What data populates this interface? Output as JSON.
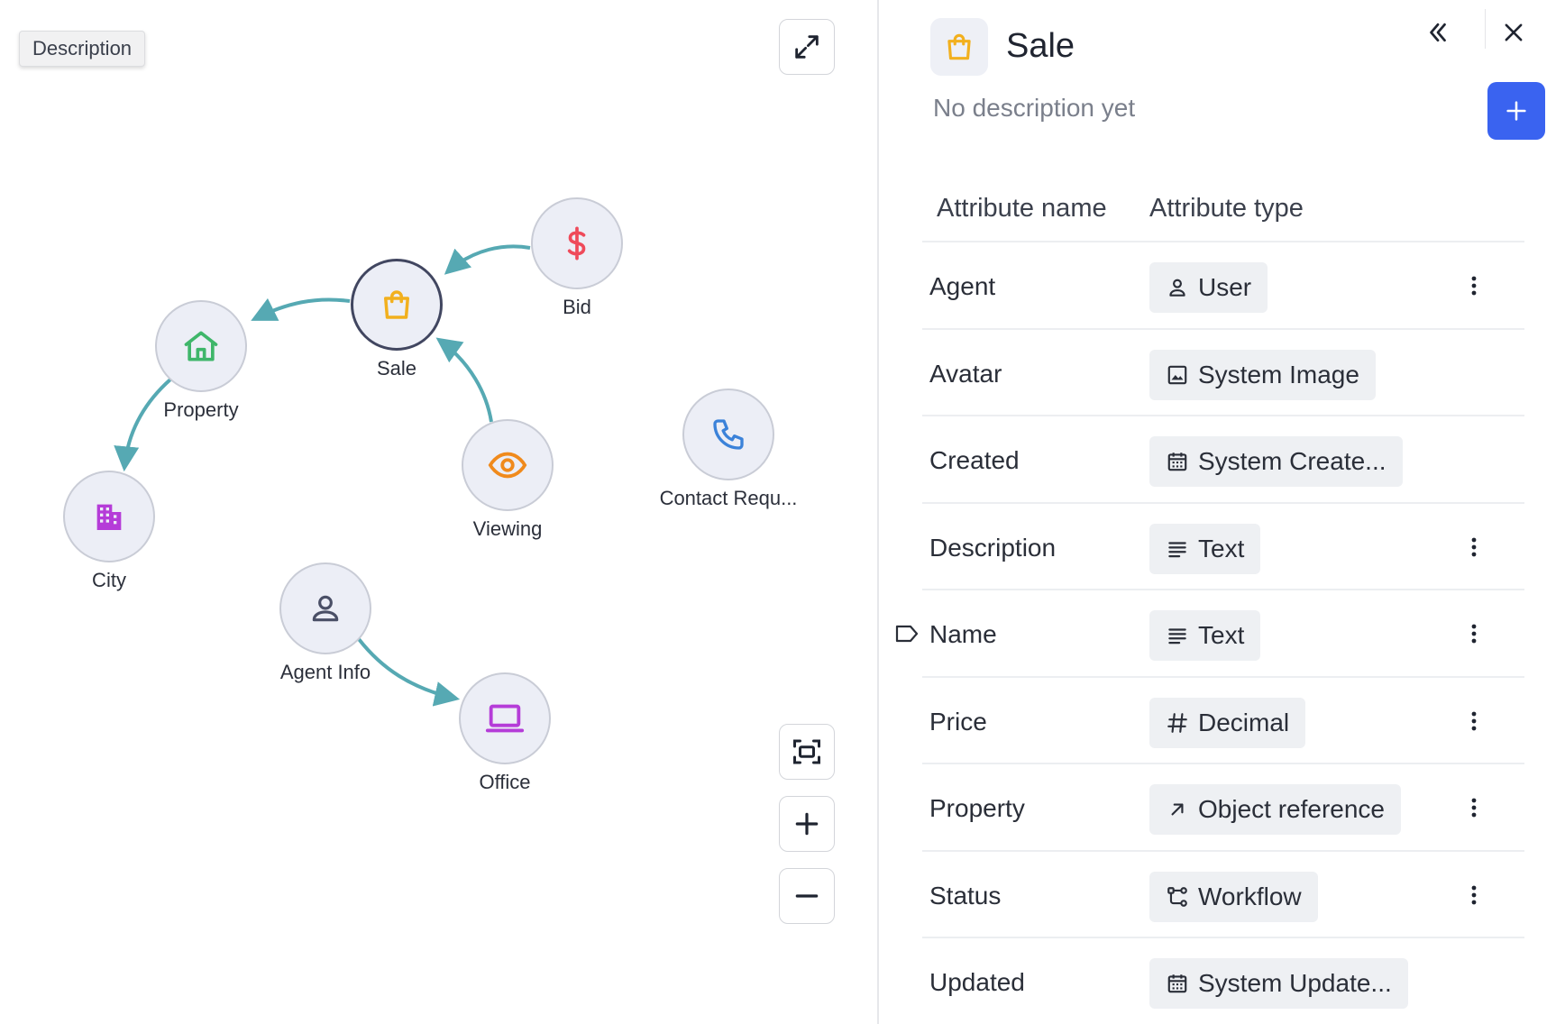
{
  "canvas": {
    "tooltip": "Description",
    "tools": {
      "expand": "expand-icon",
      "fit": "fit-view-icon",
      "zoom_in": "plus-icon",
      "zoom_out": "minus-icon"
    },
    "nodes": [
      {
        "id": "sale",
        "label": "Sale",
        "icon": "shopping-bag-icon",
        "color": "#f2b01e",
        "selected": true
      },
      {
        "id": "bid",
        "label": "Bid",
        "icon": "dollar-icon",
        "color": "#ef4a5a"
      },
      {
        "id": "property",
        "label": "Property",
        "icon": "house-icon",
        "color": "#3fb66a"
      },
      {
        "id": "city",
        "label": "City",
        "icon": "building-icon",
        "color": "#b53cd8"
      },
      {
        "id": "viewing",
        "label": "Viewing",
        "icon": "eye-icon",
        "color": "#f08a1c"
      },
      {
        "id": "contact",
        "label": "Contact Requ...",
        "icon": "phone-icon",
        "color": "#3b82d9"
      },
      {
        "id": "agent",
        "label": "Agent Info",
        "icon": "person-icon",
        "color": "#4a4f66"
      },
      {
        "id": "office",
        "label": "Office",
        "icon": "laptop-icon",
        "color": "#b53cd8"
      }
    ],
    "edges": [
      {
        "from": "bid",
        "to": "sale"
      },
      {
        "from": "sale",
        "to": "property"
      },
      {
        "from": "property",
        "to": "city"
      },
      {
        "from": "viewing",
        "to": "sale"
      },
      {
        "from": "agent",
        "to": "office"
      }
    ],
    "edge_color": "#56a9b3"
  },
  "panel": {
    "icon": "shopping-bag-icon",
    "title": "Sale",
    "description": "No description yet",
    "collapse_icon": "chevrons-left-icon",
    "close_icon": "close-icon",
    "add_icon": "plus-icon",
    "accent": "#3a63f0",
    "columns": [
      "Attribute name",
      "Attribute type"
    ],
    "attributes": [
      {
        "name": "Agent",
        "type": "User",
        "type_icon": "user-icon",
        "menu": true
      },
      {
        "name": "Avatar",
        "type": "System Image",
        "type_icon": "image-icon",
        "menu": false
      },
      {
        "name": "Created",
        "type": "System Create...",
        "type_icon": "calendar-icon",
        "menu": false
      },
      {
        "name": "Description",
        "type": "Text",
        "type_icon": "text-lines-icon",
        "menu": true
      },
      {
        "name": "Name",
        "type": "Text",
        "type_icon": "text-lines-icon",
        "menu": true,
        "primary": true
      },
      {
        "name": "Price",
        "type": "Decimal",
        "type_icon": "hash-icon",
        "menu": true
      },
      {
        "name": "Property",
        "type": "Object reference",
        "type_icon": "arrow-up-right-icon",
        "menu": true
      },
      {
        "name": "Status",
        "type": "Workflow",
        "type_icon": "workflow-icon",
        "menu": true
      },
      {
        "name": "Updated",
        "type": "System Update...",
        "type_icon": "calendar-icon",
        "menu": false
      }
    ]
  }
}
